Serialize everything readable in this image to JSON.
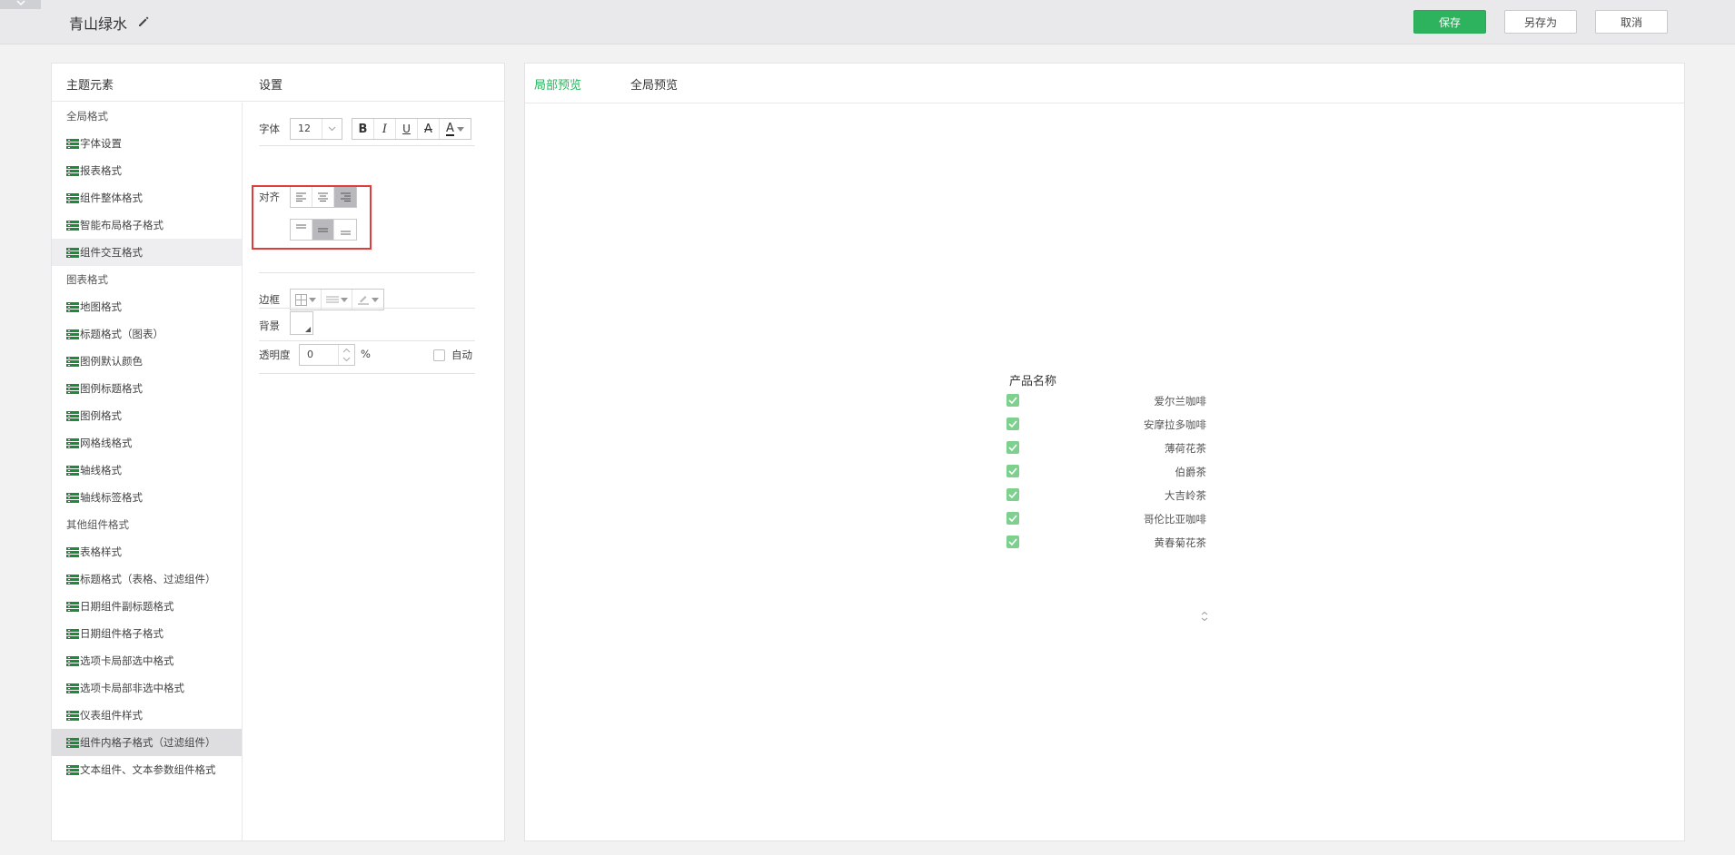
{
  "header": {
    "title": "青山绿水",
    "buttons": {
      "save": "保存",
      "save_as": "另存为",
      "cancel": "取消"
    }
  },
  "left_panel": {
    "heading_elements": "主题元素",
    "heading_settings": "设置",
    "element_list": [
      {
        "label": "全局格式",
        "kind": "group"
      },
      {
        "label": "字体设置",
        "kind": "child"
      },
      {
        "label": "报表格式",
        "kind": "child"
      },
      {
        "label": "组件整体格式",
        "kind": "child"
      },
      {
        "label": "智能布局格子格式",
        "kind": "child"
      },
      {
        "label": "组件交互格式",
        "kind": "child",
        "state": "hover"
      },
      {
        "label": "图表格式",
        "kind": "group"
      },
      {
        "label": "地图格式",
        "kind": "child"
      },
      {
        "label": "标题格式（图表）",
        "kind": "child"
      },
      {
        "label": "图例默认颜色",
        "kind": "child"
      },
      {
        "label": "图例标题格式",
        "kind": "child"
      },
      {
        "label": "图例格式",
        "kind": "child"
      },
      {
        "label": "网格线格式",
        "kind": "child"
      },
      {
        "label": "轴线格式",
        "kind": "child"
      },
      {
        "label": "轴线标签格式",
        "kind": "child"
      },
      {
        "label": "其他组件格式",
        "kind": "group"
      },
      {
        "label": "表格样式",
        "kind": "child"
      },
      {
        "label": "标题格式（表格、过滤组件）",
        "kind": "child"
      },
      {
        "label": "日期组件副标题格式",
        "kind": "child"
      },
      {
        "label": "日期组件格子格式",
        "kind": "child"
      },
      {
        "label": "选项卡局部选中格式",
        "kind": "child"
      },
      {
        "label": "选项卡局部非选中格式",
        "kind": "child"
      },
      {
        "label": "仪表组件样式",
        "kind": "child"
      },
      {
        "label": "组件内格子格式（过滤组件）",
        "kind": "child",
        "state": "selected"
      },
      {
        "label": "文本组件、文本参数组件格式",
        "kind": "child"
      }
    ],
    "settings": {
      "font_label": "字体",
      "font_size": "12",
      "bold": "B",
      "italic": "I",
      "underline": "U",
      "strike": "A",
      "font_color": "A",
      "align_label": "对齐",
      "border_label": "边框",
      "background_label": "背景",
      "opacity_label": "透明度",
      "opacity_value": "0",
      "percent": "%",
      "auto_label": "自动",
      "horizontal_align_active": "right",
      "vertical_align_active": "middle"
    }
  },
  "right_panel": {
    "tabs": [
      {
        "label": "局部预览",
        "active": true
      },
      {
        "label": "全局预览",
        "active": false
      }
    ],
    "preview": {
      "title": "产品名称",
      "items": [
        "爱尔兰咖啡",
        "安摩拉多咖啡",
        "薄荷花茶",
        "伯爵茶",
        "大吉岭茶",
        "哥伦比亚咖啡",
        "黄春菊花茶"
      ]
    }
  },
  "colors": {
    "accent": "#2db35d",
    "checkbox": "#7ed08f",
    "highlight_box": "#e23b3b",
    "icon_green": "#1f8a3a"
  }
}
